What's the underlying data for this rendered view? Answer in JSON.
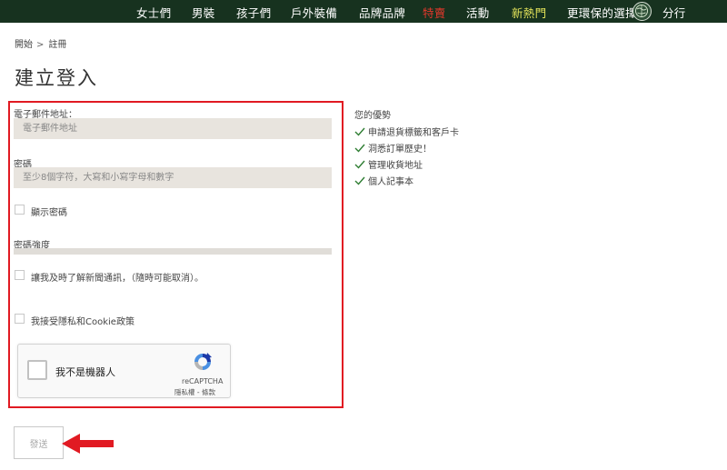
{
  "nav": {
    "items": [
      {
        "label": "女士們",
        "name": "women"
      },
      {
        "label": "男裝",
        "name": "men"
      },
      {
        "label": "孩子們",
        "name": "kids"
      },
      {
        "label": "戶外裝備",
        "name": "outdoor-gear"
      },
      {
        "label": "品牌品牌",
        "name": "brands"
      },
      {
        "label": "特賣",
        "name": "sale"
      },
      {
        "label": "活動",
        "name": "events"
      },
      {
        "label": "新熱門",
        "name": "new-hot"
      },
      {
        "label": "更環保的選擇",
        "name": "greener-choice"
      },
      {
        "label": "分行",
        "name": "branches"
      }
    ],
    "colors": {
      "background": "#17321f",
      "sale": "#e0382c",
      "new": "#e3e35a"
    },
    "eco_icon": "eco-globe-icon"
  },
  "breadcrumb": {
    "home": "開始",
    "separator": ">",
    "current": "註冊"
  },
  "page_title": "建立登入",
  "form": {
    "email_label": "電子郵件地址：",
    "email_placeholder": "電子郵件地址",
    "email_value": "",
    "password_label": "密碼",
    "password_placeholder": "至少8個字符，大寫和小寫字母和數字",
    "password_value": "",
    "show_password_label": "顯示密碼",
    "strength_label": "密碼強度",
    "newsletter_label": "讓我及時了解新聞通訊，（隨時可能取消）。",
    "privacy_label": "我接受隱私和Cookie政策",
    "highlight_color": "#e11a22"
  },
  "recaptcha": {
    "label": "我不是機器人",
    "brand": "reCAPTCHA",
    "links": "隱私權 - 條款"
  },
  "submit_label": "發送",
  "benefits": {
    "title": "您的優勢",
    "items": [
      "申請退貨標籤和客戶卡",
      "洞悉訂單歷史！",
      "管理收貨地址",
      "個人記事本"
    ],
    "check_color": "#2e7d32"
  }
}
